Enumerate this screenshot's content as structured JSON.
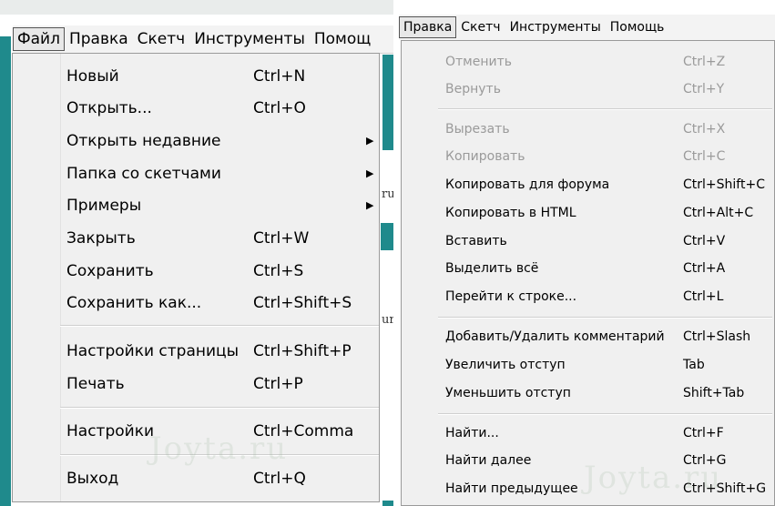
{
  "left": {
    "menubar": [
      "Файл",
      "Правка",
      "Скетч",
      "Инструменты",
      "Помощ"
    ],
    "editor_fragments": [
      "ru",
      "ur"
    ],
    "items": [
      {
        "label": "Новый",
        "shortcut": "Ctrl+N"
      },
      {
        "label": "Открыть...",
        "shortcut": "Ctrl+O"
      },
      {
        "label": "Открыть недавние",
        "shortcut": "",
        "submenu_arrow": "▶"
      },
      {
        "label": "Папка со скетчами",
        "shortcut": "",
        "submenu_arrow": "▶"
      },
      {
        "label": "Примеры",
        "shortcut": "",
        "submenu_arrow": "▶"
      },
      {
        "label": "Закрыть",
        "shortcut": "Ctrl+W"
      },
      {
        "label": "Сохранить",
        "shortcut": "Ctrl+S"
      },
      {
        "label": "Сохранить как...",
        "shortcut": "Ctrl+Shift+S"
      },
      {
        "label": "Настройки страницы",
        "shortcut": "Ctrl+Shift+P"
      },
      {
        "label": "Печать",
        "shortcut": "Ctrl+P"
      },
      {
        "label": "Настройки",
        "shortcut": "Ctrl+Comma"
      },
      {
        "label": "Выход",
        "shortcut": "Ctrl+Q"
      }
    ],
    "watermark": "Joyta.ru"
  },
  "right": {
    "menubar": [
      "Правка",
      "Скетч",
      "Инструменты",
      "Помощь"
    ],
    "items": [
      {
        "label": "Отменить",
        "shortcut": "Ctrl+Z",
        "disabled": true
      },
      {
        "label": "Вернуть",
        "shortcut": "Ctrl+Y",
        "disabled": true
      },
      {
        "label": "Вырезать",
        "shortcut": "Ctrl+X",
        "disabled": true
      },
      {
        "label": "Копировать",
        "shortcut": "Ctrl+C",
        "disabled": true
      },
      {
        "label": "Копировать для форума",
        "shortcut": "Ctrl+Shift+C"
      },
      {
        "label": "Копировать в HTML",
        "shortcut": "Ctrl+Alt+C"
      },
      {
        "label": "Вставить",
        "shortcut": "Ctrl+V"
      },
      {
        "label": "Выделить всё",
        "shortcut": "Ctrl+A"
      },
      {
        "label": "Перейти к строке...",
        "shortcut": "Ctrl+L"
      },
      {
        "label": "Добавить/Удалить комментарий",
        "shortcut": "Ctrl+Slash"
      },
      {
        "label": "Увеличить отступ",
        "shortcut": "Tab"
      },
      {
        "label": "Уменьшить отступ",
        "shortcut": "Shift+Tab"
      },
      {
        "label": "Найти...",
        "shortcut": "Ctrl+F"
      },
      {
        "label": "Найти далее",
        "shortcut": "Ctrl+G"
      },
      {
        "label": "Найти предыдущее",
        "shortcut": "Ctrl+Shift+G"
      }
    ],
    "watermark": "Joyta.ru"
  }
}
